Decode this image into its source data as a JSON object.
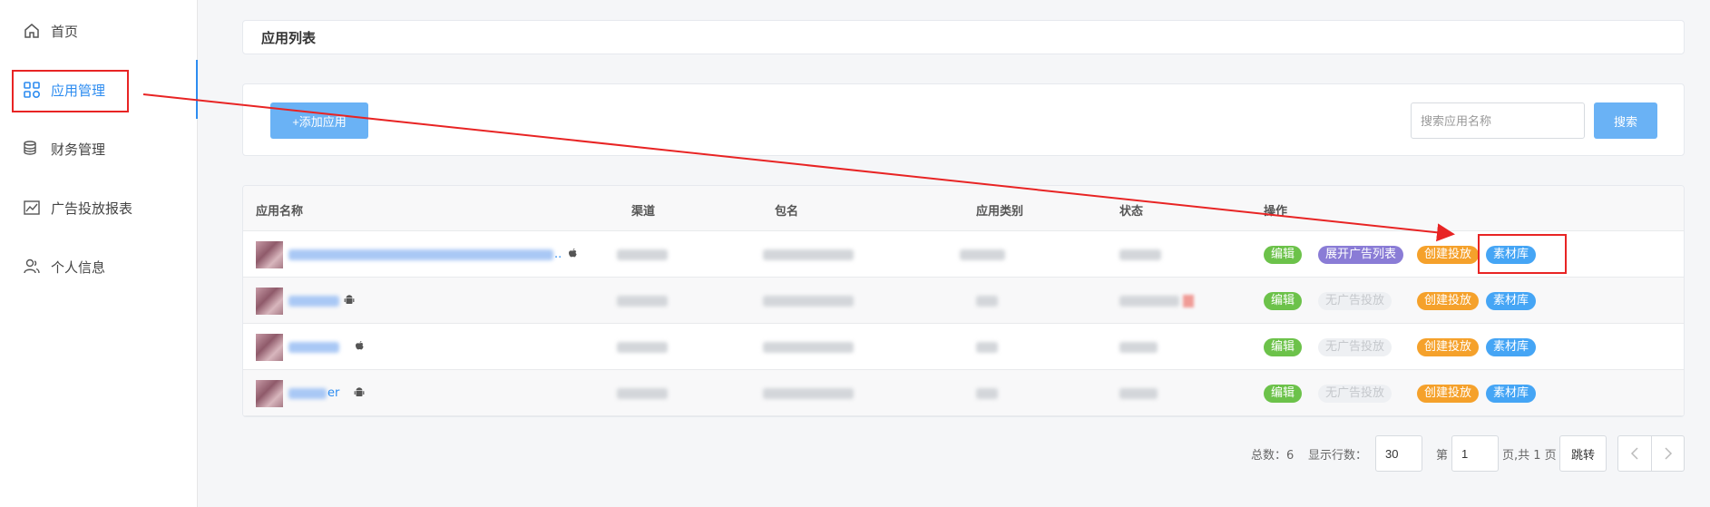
{
  "sidebar": {
    "items": [
      {
        "label": "首页",
        "icon": "home-icon"
      },
      {
        "label": "应用管理",
        "icon": "grid-icon"
      },
      {
        "label": "财务管理",
        "icon": "coins-icon"
      },
      {
        "label": "广告投放报表",
        "icon": "chart-icon"
      },
      {
        "label": "个人信息",
        "icon": "user-icon"
      }
    ]
  },
  "page_title": "应用列表",
  "toolbar": {
    "add_label": "+添加应用",
    "search_placeholder": "搜索应用名称",
    "search_label": "搜索"
  },
  "table": {
    "headers": [
      "应用名称",
      "渠道",
      "包名",
      "应用类别",
      "状态",
      "操作"
    ],
    "rows": [
      {
        "name_tail": "..",
        "os": "apple-icon",
        "actions": [
          "编辑",
          "展开广告列表",
          "创建投放",
          "素材库"
        ]
      },
      {
        "name_tail": "",
        "os": "android-icon",
        "actions": [
          "编辑",
          "无广告投放",
          "创建投放",
          "素材库"
        ]
      },
      {
        "name_tail": "",
        "os": "apple-icon",
        "actions": [
          "编辑",
          "无广告投放",
          "创建投放",
          "素材库"
        ]
      },
      {
        "name_tail": "er",
        "os": "android-icon",
        "actions": [
          "编辑",
          "无广告投放",
          "创建投放",
          "素材库"
        ]
      }
    ]
  },
  "pagination": {
    "total_label": "总数：6",
    "rows_label": "显示行数：",
    "rows_value": "30",
    "page_prefix": "第",
    "page_value": "1",
    "page_suffix": "页,共 1 页",
    "jump_label": "跳转"
  },
  "colors": {
    "accent": "#2d8cf0",
    "annotation": "#e82424"
  }
}
